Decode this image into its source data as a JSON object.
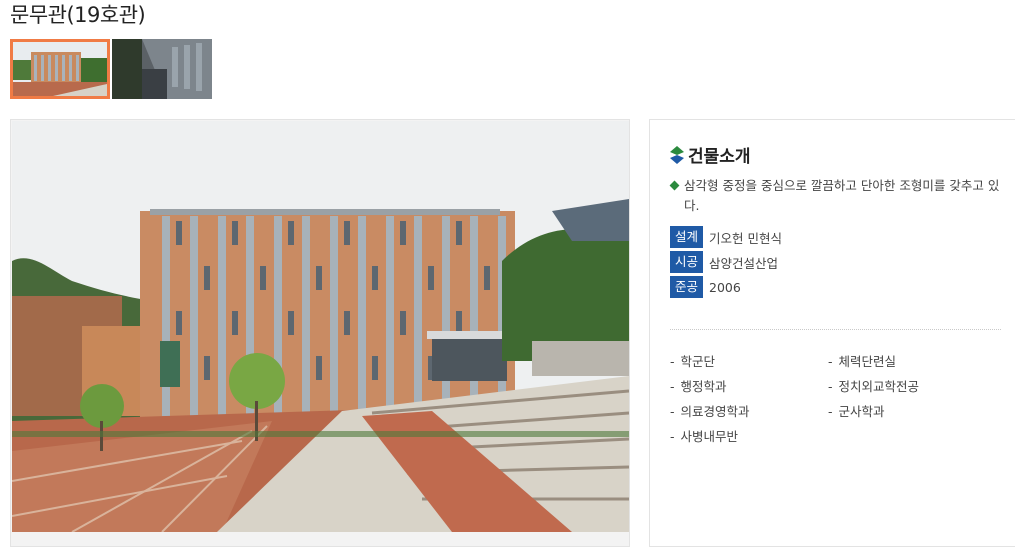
{
  "page": {
    "title": "문무관(19호관)"
  },
  "thumbnails": [
    {
      "name": "thumbnail-1",
      "active": true
    },
    {
      "name": "thumbnail-2",
      "active": false
    }
  ],
  "info": {
    "title": "건물소개",
    "description": "삼각형 중정을 중심으로 깔끔하고 단아한 조형미를 갖추고 있다.",
    "facts": [
      {
        "label": "설계",
        "value": "기오헌 민현식"
      },
      {
        "label": "시공",
        "value": "삼양건설산업"
      },
      {
        "label": "준공",
        "value": "2006"
      }
    ],
    "departments": [
      "학군단",
      "체력단련실",
      "행정학과",
      "정치외교학전공",
      "의료경영학과",
      "군사학과",
      "사병내무반"
    ]
  },
  "colors": {
    "accent_orange": "#f07b45",
    "label_blue": "#1f5aa6",
    "bullet_green": "#2b8a3e"
  }
}
